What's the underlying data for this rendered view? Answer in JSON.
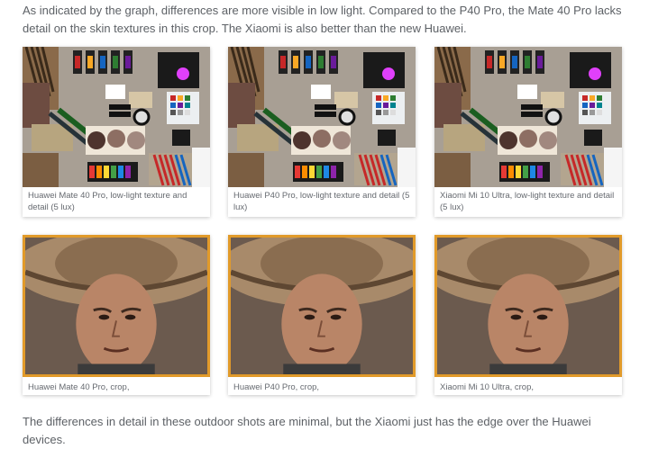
{
  "article": {
    "intro": "As indicated by the graph, differences are more visible in low light. Compared to the P40 Pro, the Mate 40 Pro lacks detail on the skin textures in this crop. The Xiaomi is also better than the new Huawei.",
    "outro": "The differences in detail in these outdoor shots are minimal, but the Xiaomi just has the edge over the Huawei devices."
  },
  "texture_row": [
    {
      "caption": "Huawei Mate 40 Pro, low-light texture and detail (5 lux)"
    },
    {
      "caption": "Huawei P40 Pro, low-light texture and detail (5 lux)"
    },
    {
      "caption": "Xiaomi Mi 10 Ultra, low-light texture and detail (5 lux)"
    }
  ],
  "crop_row": [
    {
      "caption": "Huawei Mate 40 Pro, crop,"
    },
    {
      "caption": "Huawei P40 Pro, crop,"
    },
    {
      "caption": "Xiaomi Mi 10 Ultra, crop,"
    }
  ],
  "colors": {
    "selected_border": "#e19a2a",
    "text": "#5d6166"
  }
}
